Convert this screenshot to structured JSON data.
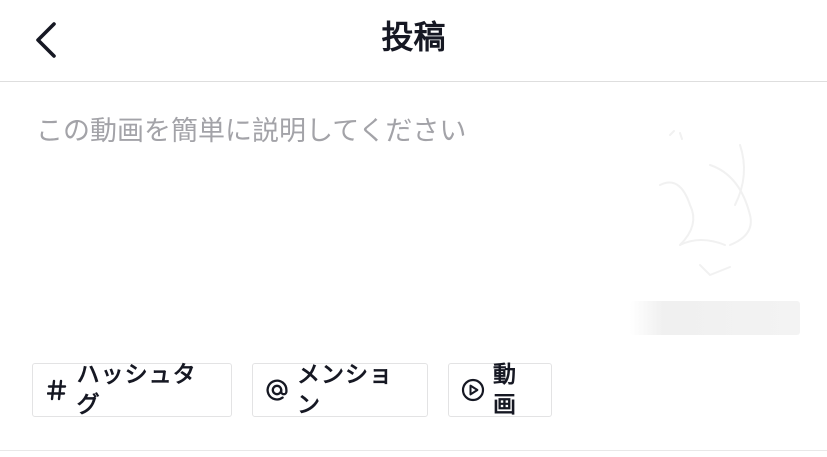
{
  "header": {
    "title": "投稿",
    "back_icon": "chevron-left-icon"
  },
  "caption": {
    "placeholder": "この動画を簡単に説明してください",
    "value": ""
  },
  "thumbnail": {
    "icon": "video-thumbnail"
  },
  "chips": {
    "hashtag": {
      "icon": "hash-icon",
      "label": "ハッシュタグ"
    },
    "mention": {
      "icon": "at-icon",
      "label": "メンション"
    },
    "video": {
      "icon": "play-circle-icon",
      "label": "動画"
    }
  },
  "colors": {
    "text": "#161823",
    "placeholder": "#a3a3a8",
    "border": "#e3e3e4",
    "divider": "#dedede"
  }
}
